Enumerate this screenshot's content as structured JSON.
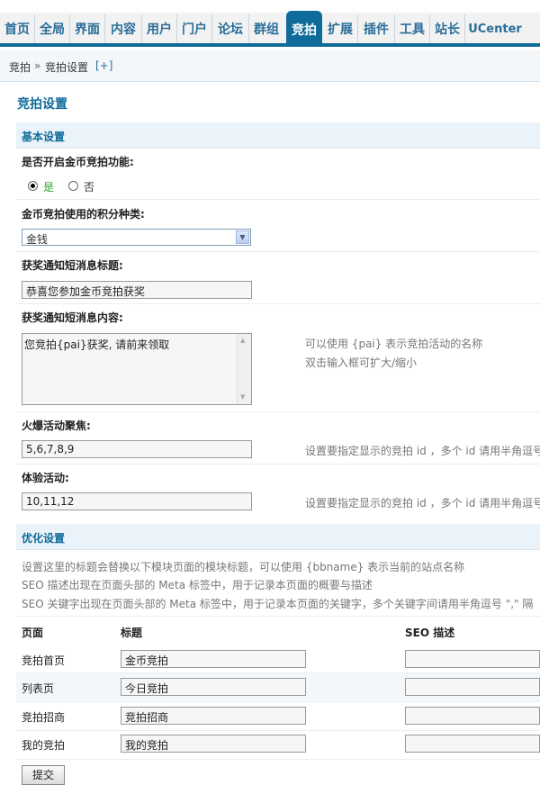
{
  "nav": {
    "tabs": [
      "首页",
      "全局",
      "界面",
      "内容",
      "用户",
      "门户",
      "论坛",
      "群组",
      "竞拍",
      "扩展",
      "插件",
      "工具",
      "站长",
      "UCenter"
    ],
    "active": "竞拍"
  },
  "breadcrumb": {
    "home": "竞拍",
    "sep": "»",
    "current": "竞拍设置",
    "add": "[+]"
  },
  "page_title": "竞拍设置",
  "basic": {
    "header": "基本设置",
    "enable_label": "是否开启金币竞拍功能:",
    "yes": "是",
    "no": "否",
    "credit_label": "金币竞拍使用的积分种类:",
    "credit_value": "金钱",
    "msg_title_label": "获奖通知短消息标题:",
    "msg_title_value": "恭喜您参加金币竞拍获奖",
    "msg_content_label": "获奖通知短消息内容:",
    "msg_content_value": "您竞拍{pai}获奖, 请前来领取",
    "msg_hint1": "可以使用 {pai} 表示竞拍活动的名称",
    "msg_hint2": "双击输入框可扩大/缩小",
    "hot_label": "火爆活动聚焦:",
    "hot_value": "5,6,7,8,9",
    "hot_hint": "设置要指定显示的竞拍 id ，多个 id 请用半角逗号",
    "trial_label": "体验活动:",
    "trial_value": "10,11,12",
    "trial_hint": "设置要指定显示的竞拍 id ，多个 id 请用半角逗号"
  },
  "seo": {
    "header": "优化设置",
    "desc1": "设置这里的标题会替换以下模块页面的模块标题，可以使用 {bbname} 表示当前的站点名称",
    "desc2": "SEO 描述出现在页面头部的 Meta 标签中，用于记录本页面的概要与描述",
    "desc3": "SEO 关键字出现在页面头部的 Meta 标签中，用于记录本页面的关键字，多个关键字间请用半角逗号 \",\" 隔",
    "col_page": "页面",
    "col_title": "标题",
    "col_desc": "SEO 描述",
    "rows": [
      {
        "page": "竞拍首页",
        "title": "金币竞拍"
      },
      {
        "page": "列表页",
        "title": "今日竞拍"
      },
      {
        "page": "竞拍招商",
        "title": "竞拍招商"
      },
      {
        "page": "我的竞拍",
        "title": "我的竞拍"
      }
    ]
  },
  "submit_label": "提交"
}
